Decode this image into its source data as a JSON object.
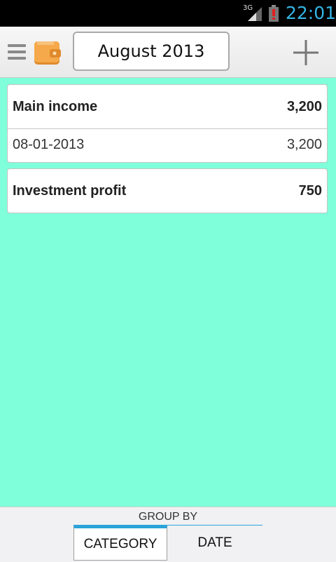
{
  "status_bar": {
    "network": "3G",
    "time": "22:01"
  },
  "action_bar": {
    "menu_icon": "menu-icon",
    "app_icon": "wallet-icon",
    "period": "August 2013",
    "add_icon": "plus-icon"
  },
  "categories": [
    {
      "name": "Main income",
      "total": "3,200",
      "entries": [
        {
          "date": "08-01-2013",
          "amount": "3,200"
        }
      ]
    },
    {
      "name": "Investment profit",
      "total": "750",
      "entries": []
    }
  ],
  "bottom_bar": {
    "label": "GROUP BY",
    "tabs": [
      "CATEGORY",
      "DATE"
    ],
    "active_tab": "CATEGORY",
    "accent_color": "#2aa3d8"
  },
  "colors": {
    "background": "#7fffda",
    "time": "#33b5e5"
  }
}
